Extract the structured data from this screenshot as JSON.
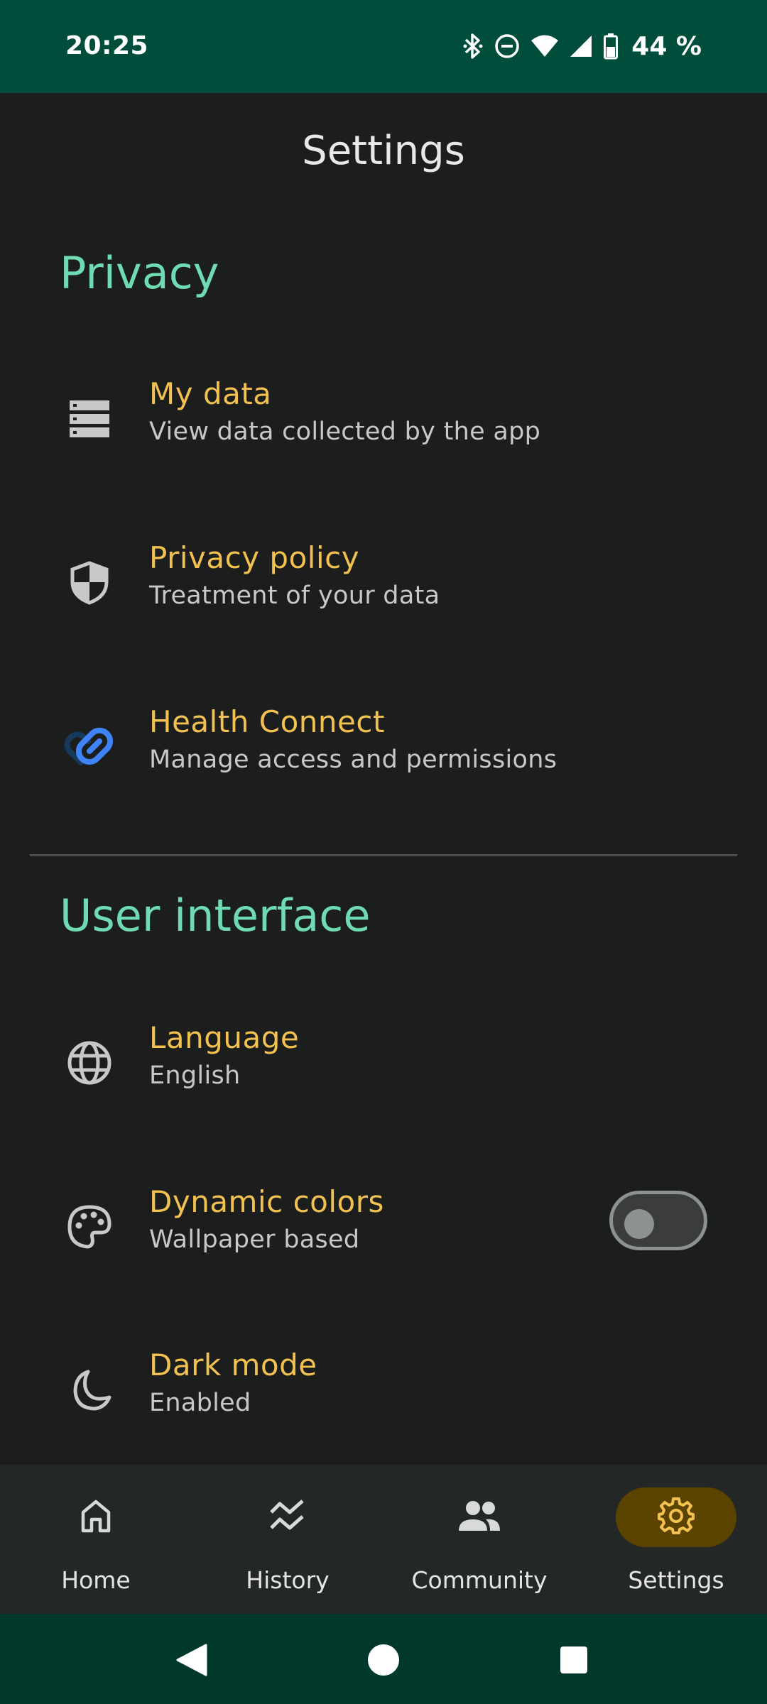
{
  "status_bar": {
    "time": "20:25",
    "battery": "44 %",
    "icons": [
      "bluetooth-icon",
      "do-not-disturb-icon",
      "wifi-icon",
      "signal-icon",
      "battery-icon"
    ]
  },
  "app_bar": {
    "title": "Settings"
  },
  "sections": {
    "privacy": {
      "header": "Privacy",
      "items": [
        {
          "title": "My data",
          "subtitle": "View data collected by the app",
          "icon": "storage-icon"
        },
        {
          "title": "Privacy policy",
          "subtitle": "Treatment of your data",
          "icon": "shield-icon"
        },
        {
          "title": "Health Connect",
          "subtitle": "Manage access and permissions",
          "icon": "health-connect-icon"
        }
      ]
    },
    "user_interface": {
      "header": "User interface",
      "items": [
        {
          "title": "Language",
          "subtitle": "English",
          "icon": "globe-icon"
        },
        {
          "title": "Dynamic colors",
          "subtitle": "Wallpaper based",
          "icon": "palette-icon",
          "toggle_on": false
        },
        {
          "title": "Dark mode",
          "subtitle": "Enabled",
          "icon": "moon-icon"
        }
      ]
    }
  },
  "bottom_nav": {
    "items": [
      {
        "label": "Home",
        "icon": "home-icon",
        "active": false
      },
      {
        "label": "History",
        "icon": "history-icon",
        "active": false
      },
      {
        "label": "Community",
        "icon": "community-icon",
        "active": false
      },
      {
        "label": "Settings",
        "icon": "gear-icon",
        "active": true
      }
    ]
  },
  "colors": {
    "status_bar": "#004d3b",
    "background": "#1c1d1d",
    "section_header": "#6fdbb2",
    "item_title": "#f2c14f",
    "active_nav_pill": "#5b4300"
  }
}
